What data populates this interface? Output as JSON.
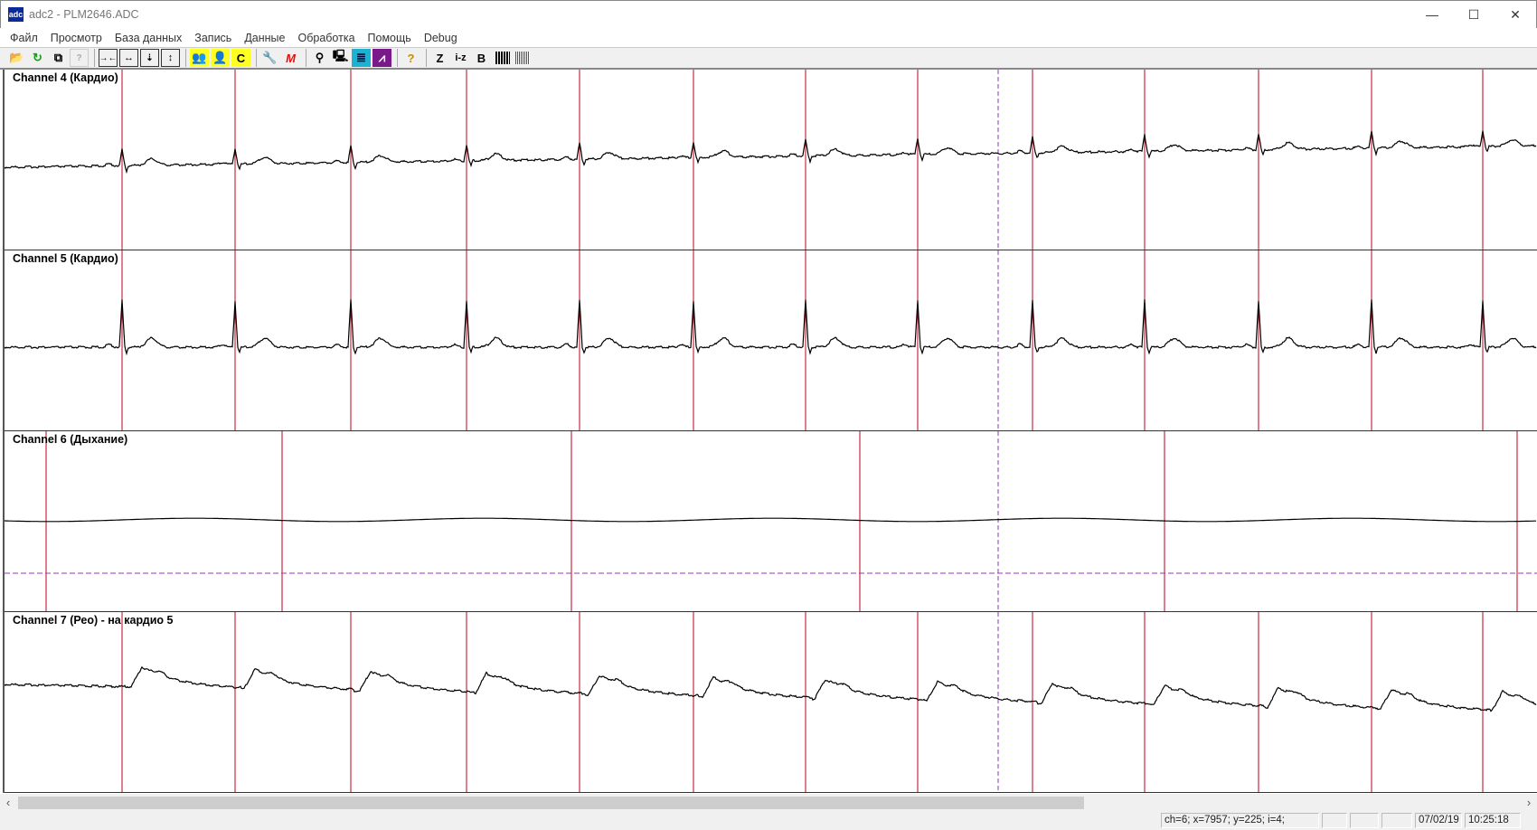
{
  "window": {
    "title": "adc2 - PLM2646.ADC",
    "icon_text": "adc",
    "minimize": "—",
    "maximize": "☐",
    "close": "✕"
  },
  "menu": [
    "Файл",
    "Просмотр",
    "База данных",
    "Запись",
    "Данные",
    "Обработка",
    "Помощь",
    "Debug"
  ],
  "toolbar": {
    "z_label": "Z",
    "iz_label": "i-z",
    "b_label": "B",
    "c_label": "C",
    "m_label": "M",
    "help_label": "?"
  },
  "channels": [
    {
      "label": "Channel 4 (Кардио)",
      "type": "ecg1"
    },
    {
      "label": "Channel 5 (Кардио)",
      "type": "ecg2"
    },
    {
      "label": "Channel 6 (Дыхание)",
      "type": "resp"
    },
    {
      "label": "Channel 7 (Рео) - на кардио 5",
      "type": "reo"
    }
  ],
  "colors": {
    "marker": "#c0001a",
    "cursor": "#9b30c8",
    "trace": "#000000"
  },
  "scroll": {
    "left": "‹",
    "right": "›",
    "position_fraction": 0.71
  },
  "status": {
    "cursor_info": "ch=6; x=7957; y=225; i=4;",
    "date": "07/02/19",
    "time": "10:25:18"
  }
}
